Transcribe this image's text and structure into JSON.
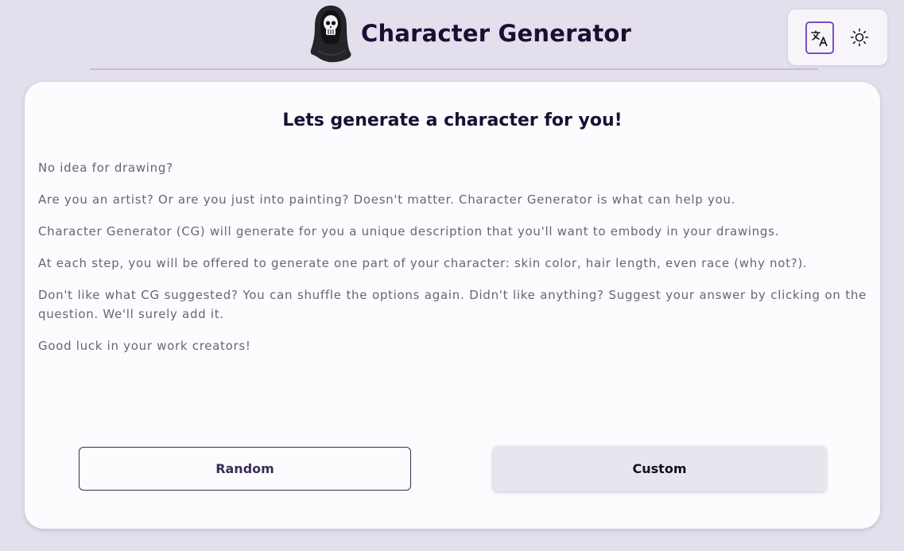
{
  "header": {
    "title": "Character Generator",
    "logo_icon": "grim-reaper-skull-icon"
  },
  "toolbar": {
    "translate_icon": "translate-icon",
    "theme_icon": "sun-icon",
    "accent_color": "#7b4fc0"
  },
  "main": {
    "heading": "Lets generate a character for you!",
    "paragraphs": [
      "No idea for drawing?",
      "Are you an artist? Or are you just into painting? Doesn't matter. Character Generator is what can help you.",
      "Character Generator (CG) will generate for you a unique description that you'll want to embody in your drawings.",
      "At each step, you will be offered to generate one part of your character: skin color, hair length, even race (why not?).",
      "Don't like what CG suggested? You can shuffle the options again. Didn't like anything? Suggest your answer by clicking on the question. We'll surely add it.",
      "Good luck in your work creators!"
    ],
    "random_label": "Random",
    "custom_label": "Custom"
  }
}
